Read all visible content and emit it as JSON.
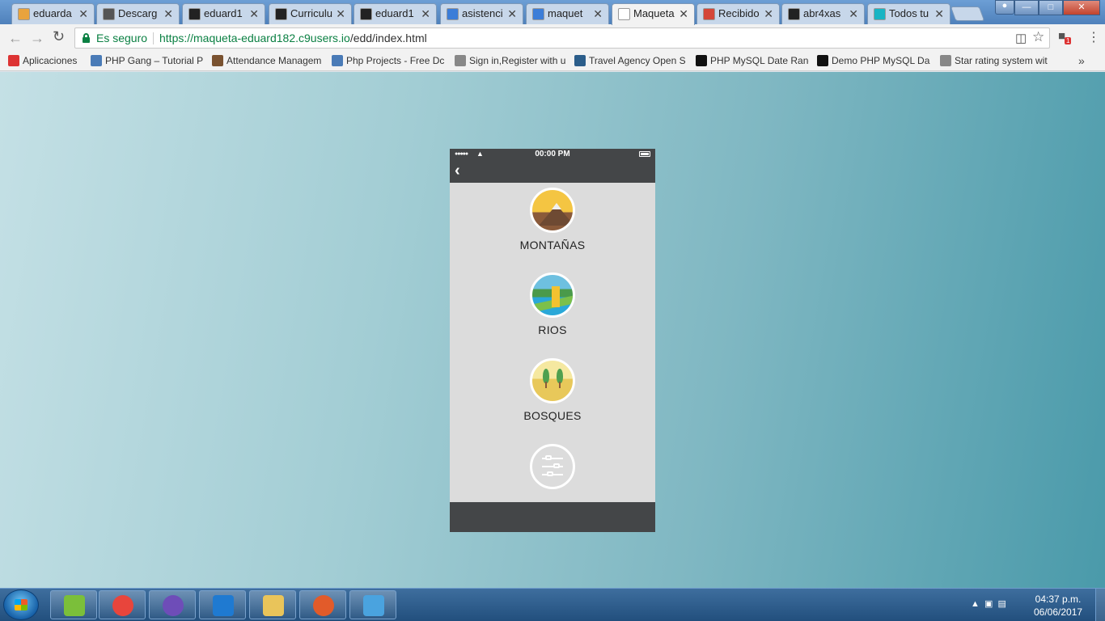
{
  "browser": {
    "tabs": [
      {
        "title": "eduarda",
        "favicon_color": "#e8a33d",
        "active": false
      },
      {
        "title": "Descarg",
        "favicon_color": "#555555",
        "active": false
      },
      {
        "title": "eduard1",
        "favicon_color": "#222222",
        "active": false
      },
      {
        "title": "Curriculu",
        "favicon_color": "#222222",
        "active": false
      },
      {
        "title": "eduard1",
        "favicon_color": "#222222",
        "active": false
      },
      {
        "title": "asistenci",
        "favicon_color": "#3b7dd8",
        "active": false
      },
      {
        "title": "maquet",
        "favicon_color": "#3b7dd8",
        "active": false
      },
      {
        "title": "Maqueta",
        "favicon_color": "#ffffff",
        "active": true
      },
      {
        "title": "Recibido",
        "favicon_color": "#d44638",
        "active": false
      },
      {
        "title": "abr4xas",
        "favicon_color": "#222222",
        "active": false
      },
      {
        "title": "Todos tu",
        "favicon_color": "#18b4c4",
        "active": false
      }
    ],
    "close_glyph": "✕",
    "secure_label": "Es seguro",
    "url_base": "https://maqueta-eduard182.c9users.io",
    "url_path": "/edd/index.html",
    "icons": {
      "back": "back-arrow-icon",
      "forward": "forward-arrow-icon",
      "reload": "reload-icon",
      "star": "star-icon",
      "menu": "menu-icon"
    },
    "badge_count": "1",
    "bookmarks": [
      {
        "label": "Aplicaciones",
        "icon_color": "#d33"
      },
      {
        "label": "PHP Gang – Tutorial P",
        "icon_color": "#4a7bb7"
      },
      {
        "label": "Attendance Managem",
        "icon_color": "#7a5230"
      },
      {
        "label": "Php Projects - Free Dc",
        "icon_color": "#4a7bb7"
      },
      {
        "label": "Sign in,Register with u",
        "icon_color": "#888888"
      },
      {
        "label": "Travel Agency Open S",
        "icon_color": "#2b5d8a"
      },
      {
        "label": "PHP MySQL Date Ranc",
        "icon_color": "#111111"
      },
      {
        "label": "Demo PHP MySQL Da",
        "icon_color": "#111111"
      },
      {
        "label": "Star rating system wit",
        "icon_color": "#888888"
      }
    ],
    "bookmarks_more": "»"
  },
  "phone": {
    "time": "00:00 PM",
    "signal": "●●●●●",
    "back_glyph": "‹",
    "categories": [
      {
        "label": "MONTAÑAS",
        "icon": "mountain-icon"
      },
      {
        "label": "RIOS",
        "icon": "river-icon"
      },
      {
        "label": "BOSQUES",
        "icon": "forest-icon"
      },
      {
        "label": "",
        "icon": "settings-sliders-icon"
      }
    ]
  },
  "taskbar": {
    "apps": [
      {
        "name": "bluestacks",
        "color": "#7bbf3a"
      },
      {
        "name": "chrome",
        "color": "#e8453c"
      },
      {
        "name": "github-desktop",
        "color": "#6e4db8"
      },
      {
        "name": "visual-studio-code",
        "color": "#1f7ad1"
      },
      {
        "name": "file-explorer",
        "color": "#e9c45a"
      },
      {
        "name": "app-ring",
        "color": "#e25b2a"
      },
      {
        "name": "paint",
        "color": "#4aa3df"
      }
    ],
    "time": "04:37 p.m.",
    "date": "06/06/2017"
  }
}
